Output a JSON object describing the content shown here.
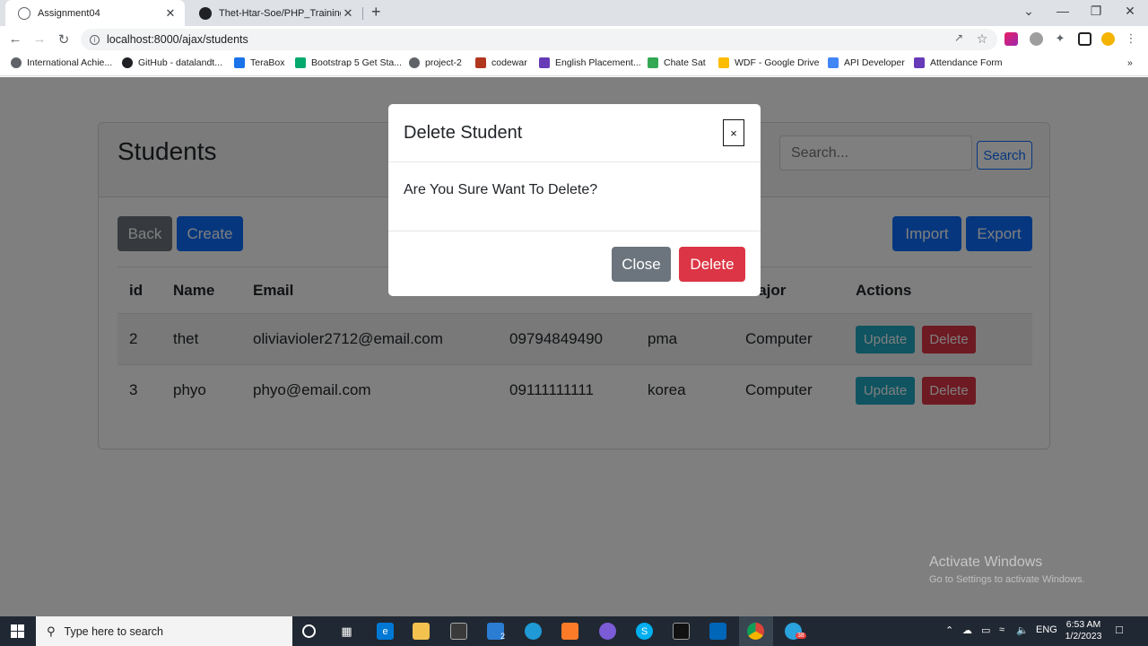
{
  "browser": {
    "tabs": [
      {
        "title": "Assignment04",
        "close": "✕"
      },
      {
        "title": "Thet-Htar-Soe/PHP_Training",
        "close": "✕"
      }
    ],
    "new_tab": "+",
    "window_controls": {
      "dropdown": "⌄",
      "minimize": "—",
      "maximize": "❐",
      "close": "✕"
    },
    "url": "localhost:8000/ajax/students",
    "bookmarks": [
      {
        "label": "International Achie...",
        "icon": "globe-icon",
        "color": "#5f6368"
      },
      {
        "label": "GitHub - datalandt...",
        "icon": "github-icon",
        "color": "#202124"
      },
      {
        "label": "TeraBox",
        "icon": "terabox-icon",
        "color": "#1a73e8"
      },
      {
        "label": "Bootstrap 5 Get Sta...",
        "icon": "w3-icon",
        "color": "#04aa6d"
      },
      {
        "label": "project-2",
        "icon": "globe-icon",
        "color": "#5f6368"
      },
      {
        "label": "codewar",
        "icon": "codewars-icon",
        "color": "#b1361e"
      },
      {
        "label": "English Placement...",
        "icon": "form-icon",
        "color": "#673ab7"
      },
      {
        "label": "Chate Sat",
        "icon": "chat-icon",
        "color": "#34a853"
      },
      {
        "label": "WDF - Google Drive",
        "icon": "drive-icon",
        "color": "#fbbc04"
      },
      {
        "label": "API Developer",
        "icon": "cloud-icon",
        "color": "#4285f4"
      },
      {
        "label": "Attendance Form",
        "icon": "form-icon",
        "color": "#673ab7"
      }
    ],
    "bookmarks_more": "»"
  },
  "page": {
    "title": "Students",
    "search_placeholder": "Search...",
    "search_button": "Search",
    "back_button": "Back",
    "create_button": "Create",
    "import_button": "Import",
    "export_button": "Export",
    "table": {
      "headers": [
        "id",
        "Name",
        "Email",
        "",
        "",
        "Major",
        "Actions"
      ],
      "rows": [
        {
          "id": "2",
          "name": "thet",
          "email": "oliviavioler2712@email.com",
          "phone": "09794849490",
          "address": "pma",
          "major": "Computer"
        },
        {
          "id": "3",
          "name": "phyo",
          "email": "phyo@email.com",
          "phone": "09111111111",
          "address": "korea",
          "major": "Computer"
        }
      ],
      "update_label": "Update",
      "delete_label": "Delete"
    }
  },
  "modal": {
    "title": "Delete Student",
    "close_x": "×",
    "body": "Are You Sure Want To Delete?",
    "close_button": "Close",
    "delete_button": "Delete"
  },
  "watermark": {
    "line1": "Activate Windows",
    "line2": "Go to Settings to activate Windows."
  },
  "taskbar": {
    "search_placeholder": "Type here to search",
    "mail_badge": "2",
    "telegram_badge": "38",
    "language": "ENG",
    "time": "6:53 AM",
    "date": "1/2/2023"
  },
  "colors": {
    "primary": "#0d6efd",
    "secondary": "#6c757d",
    "danger": "#dc3545",
    "info": "#1fa9c0"
  }
}
